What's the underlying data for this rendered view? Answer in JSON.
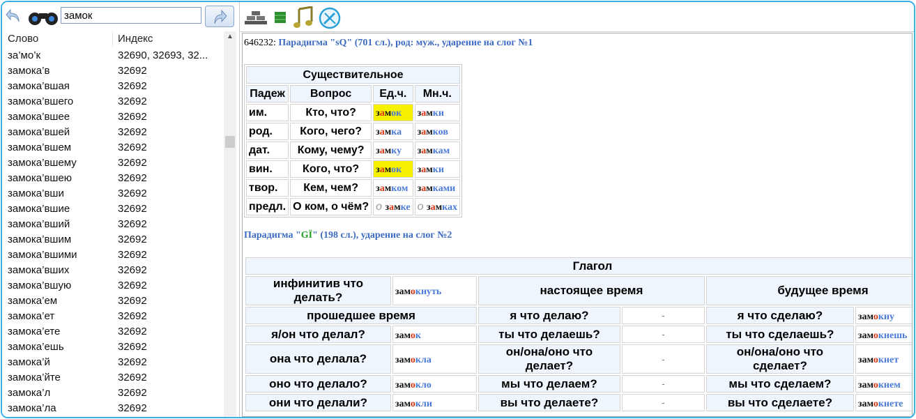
{
  "left": {
    "search_value": "замок",
    "col_word": "Слово",
    "col_index": "Индекс",
    "rows": [
      {
        "w": "за’мо’к",
        "i": "32690, 32693, 32..."
      },
      {
        "w": "замока’в",
        "i": "32692"
      },
      {
        "w": "замока’вшая",
        "i": "32692"
      },
      {
        "w": "замока’вшего",
        "i": "32692"
      },
      {
        "w": "замока’вшее",
        "i": "32692"
      },
      {
        "w": "замока’вшей",
        "i": "32692"
      },
      {
        "w": "замока’вшем",
        "i": "32692"
      },
      {
        "w": "замока’вшему",
        "i": "32692"
      },
      {
        "w": "замока’вшею",
        "i": "32692"
      },
      {
        "w": "замока’вши",
        "i": "32692"
      },
      {
        "w": "замока’вшие",
        "i": "32692"
      },
      {
        "w": "замока’вший",
        "i": "32692"
      },
      {
        "w": "замока’вшим",
        "i": "32692"
      },
      {
        "w": "замока’вшими",
        "i": "32692"
      },
      {
        "w": "замока’вших",
        "i": "32692"
      },
      {
        "w": "замока’вшую",
        "i": "32692"
      },
      {
        "w": "замока’ем",
        "i": "32692"
      },
      {
        "w": "замока’ет",
        "i": "32692"
      },
      {
        "w": "замока’ете",
        "i": "32692"
      },
      {
        "w": "замока’ешь",
        "i": "32692"
      },
      {
        "w": "замока’й",
        "i": "32692"
      },
      {
        "w": "замока’йте",
        "i": "32692"
      },
      {
        "w": "замока’л",
        "i": "32692"
      },
      {
        "w": "замока’ла",
        "i": "32692"
      }
    ]
  },
  "noun_block": {
    "id": "646232:",
    "header": "Парадигма \"sQ\" (701 сл.), род: муж., ударение на слог №1",
    "title": "Существительное",
    "h_case": "Падеж",
    "h_question": "Вопрос",
    "h_sg": "Ед.ч.",
    "h_pl": "Мн.ч.",
    "rows": [
      {
        "c": "им.",
        "q": "Кто, что?",
        "sg": "замок",
        "pl": "замки"
      },
      {
        "c": "род.",
        "q": "Кого, чего?",
        "sg": "замка",
        "pl": "замков"
      },
      {
        "c": "дат.",
        "q": "Кому, чему?",
        "sg": "замку",
        "pl": "замкам"
      },
      {
        "c": "вин.",
        "q": "Кого, что?",
        "sg": "замок",
        "pl": "замки"
      },
      {
        "c": "твор.",
        "q": "Кем, чем?",
        "sg": "замком",
        "pl": "замками"
      },
      {
        "c": "предл.",
        "q": "О ком, о чём?",
        "sg": "замке",
        "pl": "замках",
        "prep": "о"
      }
    ]
  },
  "verb_block": {
    "header_prefix": "Парадигма \"",
    "header_code": "GÏ",
    "header_suffix": "\" (198 сл.), ударение на слог №2",
    "title": "Глагол",
    "infinitive_q": "инфинитив что делать?",
    "infinitive": "замокнуть",
    "present": "настоящее время",
    "future": "будущее время",
    "past": "прошедшее время",
    "rows": [
      {
        "pq": "я/он что делал?",
        "pv": "замок",
        "nq": "ты что делаешь?",
        "nv": "-",
        "fq": "ты что сделаешь?",
        "fv": "замокнешь"
      },
      {
        "pq": "она что делала?",
        "pv": "замокла",
        "nq": "он/она/оно что делает?",
        "nv": "-",
        "fq": "он/она/оно что сделает?",
        "fv": "замокнет"
      },
      {
        "pq": "оно что делало?",
        "pv": "замокло",
        "nq": "мы что делаем?",
        "nv": "-",
        "fq": "мы что сделаем?",
        "fv": "замокнем"
      },
      {
        "pq": "они что делали?",
        "pv": "замокли",
        "nq": "вы что делаете?",
        "nv": "-",
        "fq": "вы что сделаете?",
        "fv": "замокнете"
      }
    ],
    "first_row": {
      "nq": "я что делаю?",
      "nv": "-",
      "fq": "я что сделаю?",
      "fv": "замокну"
    }
  },
  "icons": {
    "back": "back-arrow-icon",
    "binoculars": "binoculars-icon",
    "up": "up-arrow-icon",
    "bricks": "bricks-icon",
    "square": "green-square-icon",
    "music": "music-note-icon",
    "tools": "tools-icon"
  },
  "colors": {
    "accent": "#39b1e6",
    "link": "#3d6bc2",
    "highlight": "#f6f100",
    "green": "#28a025"
  }
}
